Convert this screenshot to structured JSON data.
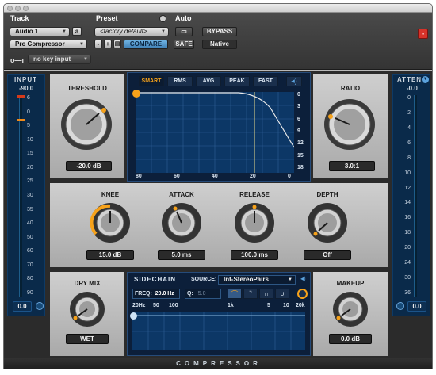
{
  "header": {
    "track_label": "Track",
    "preset_label": "Preset",
    "auto_label": "Auto",
    "track_name": "Audio 1",
    "track_channel": "a",
    "plugin_name": "Pro Compressor",
    "preset_name": "<factory default>",
    "minus_label": "-",
    "plus_label": "+",
    "compare_label": "COMPARE",
    "safe_label": "SAFE",
    "bypass_label": "BYPASS",
    "native_label": "Native",
    "key_input": "no key input"
  },
  "input_meter": {
    "label": "INPUT",
    "peak": "-90.0",
    "value": "0.0",
    "scale": [
      "6",
      "0",
      "5",
      "10",
      "15",
      "20",
      "25",
      "30",
      "35",
      "40",
      "50",
      "60",
      "70",
      "80",
      "90"
    ]
  },
  "atten_meter": {
    "label": "ATTEN",
    "peak": "-0.0",
    "value": "0.0",
    "scale": [
      "0",
      "2",
      "4",
      "6",
      "8",
      "10",
      "12",
      "14",
      "16",
      "18",
      "20",
      "24",
      "30",
      "36"
    ]
  },
  "threshold": {
    "label": "THRESHOLD",
    "value": "-20.0 dB"
  },
  "ratio": {
    "label": "RATIO",
    "value": "3.0:1"
  },
  "graph": {
    "tabs": [
      "SMART",
      "RMS",
      "AVG",
      "PEAK",
      "FAST"
    ],
    "active_tab": "SMART",
    "speaker_icon": "speaker-icon",
    "x_ticks": [
      "80",
      "60",
      "40",
      "20",
      "0"
    ],
    "y_ticks": [
      "0",
      "3",
      "6",
      "9",
      "12",
      "15",
      "18"
    ]
  },
  "knee": {
    "label": "KNEE",
    "value": "15.0 dB"
  },
  "attack": {
    "label": "ATTACK",
    "value": "5.0 ms"
  },
  "release": {
    "label": "RELEASE",
    "value": "100.0 ms"
  },
  "depth": {
    "label": "DEPTH",
    "value": "Off"
  },
  "dry_mix": {
    "label": "DRY MIX",
    "value": "WET"
  },
  "makeup": {
    "label": "MAKEUP",
    "value": "0.0 dB"
  },
  "sidechain": {
    "label": "SIDECHAIN",
    "source_label": "SOURCE:",
    "source_value": "Int-StereoPairs",
    "freq_label": "FREQ:",
    "freq_value": "20.0 Hz",
    "q_label": "Q:",
    "q_value": "5.0",
    "axis": [
      "20Hz",
      "50",
      "100",
      "1k",
      "5",
      "10",
      "20k"
    ]
  },
  "footer_title": "COMPRESSOR",
  "colors": {
    "accent": "#f7a21a",
    "meter_bg": "#0a2a4a",
    "graph_bg": "#0c1f3a",
    "selected_button": "#5a9fd6",
    "close_red": "#d6332a"
  }
}
